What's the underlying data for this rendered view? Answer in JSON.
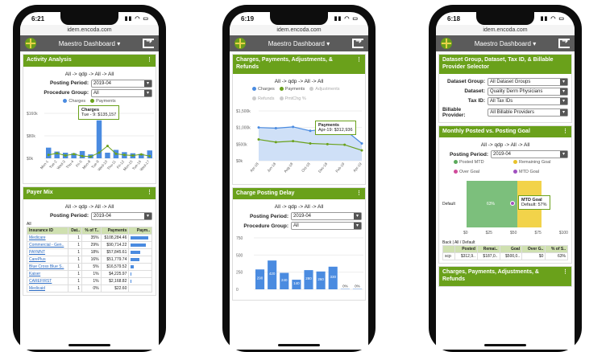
{
  "phone1": {
    "time": "6:21",
    "url": "idem.encoda.com",
    "title": "Maestro Dashboard",
    "activity": {
      "header": "Activity Analysis",
      "crumb": "All -> qdp -> All -> All",
      "posting_label": "Posting Period:",
      "posting_value": "2019-04",
      "proc_label": "Procedure Group:",
      "proc_value": "All",
      "legend_charges": "Charges",
      "legend_payments": "Payments",
      "tooltip_title": "Charges",
      "tooltip_value": "Tue - 9: $135,157"
    },
    "payer": {
      "header": "Payer Mix",
      "crumb": "All -> qdp -> All -> All",
      "posting_label": "Posting Period:",
      "posting_value": "2019-04",
      "all_label": "All",
      "columns": [
        "Insurance ID",
        "Dat..",
        "% of T..",
        "Payments",
        "Paym.."
      ],
      "rows": [
        [
          "Medicare",
          "1",
          "35%",
          "$108,284.46"
        ],
        [
          "Commercial - Gen..",
          "1",
          "29%",
          "$90,714.22"
        ],
        [
          "PAYMNT",
          "1",
          "18%",
          "$57,845.61"
        ],
        [
          "CarePlus",
          "1",
          "16%",
          "$51,779.74"
        ],
        [
          "Blue Cross Blue S..",
          "1",
          "5%",
          "$16,579.52"
        ],
        [
          "Kaiser",
          "1",
          "1%",
          "$4,225.97"
        ],
        [
          "CAREFIRST",
          "1",
          "1%",
          "$2,168.82"
        ],
        [
          "Medicaid",
          "1",
          "0%",
          "$22.60"
        ]
      ],
      "bar_fracs": [
        1.0,
        0.84,
        0.53,
        0.48,
        0.15,
        0.04,
        0.02,
        0.0
      ]
    }
  },
  "phone2": {
    "time": "6:19",
    "url": "idem.encoda.com",
    "title": "Maestro Dashboard",
    "cpar": {
      "header": "Charges, Payments, Adjustments, & Refunds",
      "crumb": "All -> qdp -> All -> All",
      "legend": [
        "Charges",
        "Payments",
        "Adjustments",
        "Refunds",
        "PmtChg %"
      ],
      "tooltip_title": "Payments",
      "tooltip_value": "Apr-19: $312,936"
    },
    "delay": {
      "header": "Charge Posting Delay",
      "crumb": "All -> qdp -> All -> All",
      "posting_label": "Posting Period:",
      "posting_value": "2019-04",
      "proc_label": "Procedure Group:",
      "proc_value": "All"
    }
  },
  "phone3": {
    "time": "6:18",
    "url": "idem.encoda.com",
    "title": "Maestro Dashboard",
    "selector": {
      "header": "Dataset Group, Dataset, Tax ID, & Billable Provider Selector",
      "fields": [
        {
          "label": "Dataset Group:",
          "value": "All Dataset Groups"
        },
        {
          "label": "Dataset:",
          "value": "Quality Derm Physicians"
        },
        {
          "label": "Tax ID:",
          "value": "All Tax IDs"
        },
        {
          "label": "Billable Provider:",
          "value": "All Billable Providers"
        }
      ]
    },
    "goal": {
      "header": "Monthly Posted vs. Posting Goal",
      "crumb": "All -> qdp -> All -> All",
      "posting_label": "Posting Period:",
      "posting_value": "2019-04",
      "legend": [
        "Posted MTD",
        "Remaining Goal",
        "Over Goal",
        "MTD Goal"
      ],
      "row_label": "Default",
      "bar_label": "63%",
      "tooltip_title": "MTD Goal",
      "tooltip_value": "Default: 57%",
      "xticks": [
        "$0",
        "$25",
        "$50",
        "$75",
        "$100"
      ],
      "back": "Back",
      "crumb2": "All / Default",
      "columns": [
        "",
        "Posted",
        "Remai..",
        "Goal",
        "Over G..",
        "% of S.."
      ],
      "row": [
        "scp",
        "$312,9..",
        "$187,0..",
        "$500,0..",
        "$0",
        "63%"
      ]
    },
    "cpar2": {
      "header": "Charges, Payments, Adjustments, & Refunds"
    }
  },
  "chart_data": [
    {
      "type": "bar",
      "categories": [
        "Mon-1",
        "Tue-2",
        "Wed-3",
        "Thu-4",
        "Fri-5",
        "Mon-8",
        "Tue-9",
        "Wed-10",
        "Thu-11",
        "Fri-12",
        "Mon-15",
        "Tue-16",
        "Wed-17"
      ],
      "series": [
        {
          "name": "Charges",
          "values": [
            38,
            24,
            20,
            18,
            26,
            14,
            135,
            20,
            30,
            22,
            18,
            16,
            28
          ]
        },
        {
          "name": "Payments",
          "values": [
            12,
            18,
            10,
            15,
            8,
            6,
            20,
            44,
            16,
            12,
            10,
            14,
            8
          ]
        }
      ],
      "ylabels": [
        "$160k",
        "$80k",
        "$0k"
      ]
    },
    {
      "type": "line",
      "categories": [
        "Apr-18",
        "Jun-18",
        "Aug-18",
        "Oct-18",
        "Dec-18",
        "Feb-19",
        "Apr-19"
      ],
      "series": [
        {
          "name": "Charges",
          "values": [
            1000,
            980,
            1020,
            900,
            960,
            940,
            520
          ]
        },
        {
          "name": "Payments",
          "values": [
            640,
            560,
            590,
            520,
            500,
            480,
            313
          ]
        }
      ],
      "ylabels": [
        "$1,500k",
        "$1,000k",
        "$500k",
        "$0k"
      ]
    },
    {
      "type": "bar",
      "values": [
        290,
        420,
        240,
        140,
        280,
        260,
        330,
        5,
        5
      ],
      "bar_labels": [
        "290",
        "420",
        "240",
        "140",
        "280",
        "260",
        "330",
        "0%",
        "0%"
      ],
      "ylabels": [
        "750",
        "500",
        "250",
        "0"
      ]
    }
  ]
}
